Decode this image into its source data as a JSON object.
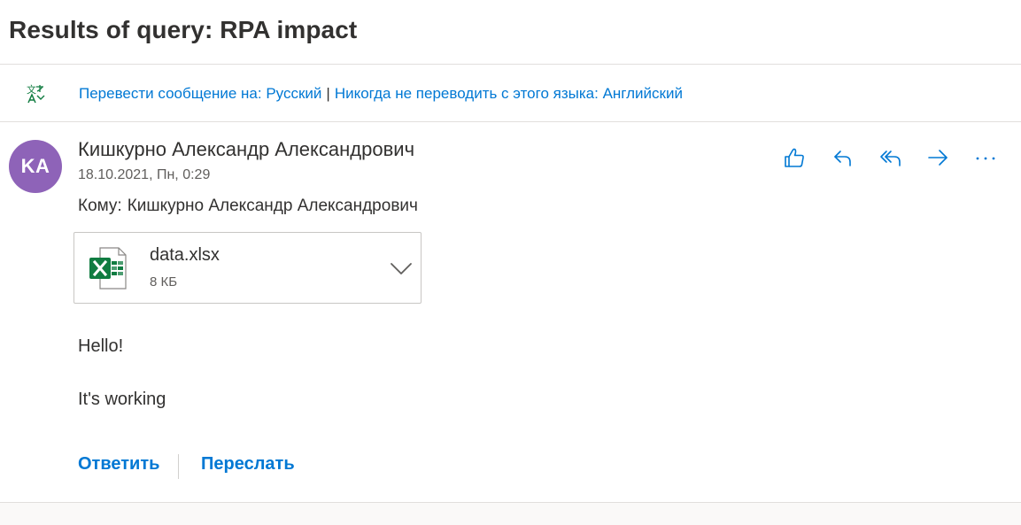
{
  "message": {
    "subject": "Results of query: RPA impact",
    "translation": {
      "translate_link": "Перевести сообщение на: Русский",
      "separator": "|",
      "never_translate_link": "Никогда не переводить с этого языка: Английский"
    },
    "sender": {
      "initials": "KA",
      "name": "Кишкурно Александр Александрович",
      "avatar_color": "#8e63b8"
    },
    "date": "18.10.2021, Пн, 0:29",
    "recipients": {
      "label": "Кому:",
      "names": "Кишкурно Александр Александрович"
    },
    "attachment": {
      "file_name": "data.xlsx",
      "file_size": "8 КБ",
      "icon": "excel-icon"
    },
    "body_lines": [
      "Hello!",
      "It's working"
    ],
    "actions": {
      "like": "thumbs-up-icon",
      "reply": "reply-icon",
      "reply_all": "reply-all-icon",
      "forward": "forward-icon",
      "more": "more-icon"
    },
    "footer_actions": {
      "reply_label": "Ответить",
      "forward_label": "Переслать"
    }
  },
  "colors": {
    "accent": "#0078d4",
    "text": "#323130",
    "secondary_text": "#605e5c",
    "divider": "#e1dfdd",
    "excel_green": "#107c41"
  }
}
